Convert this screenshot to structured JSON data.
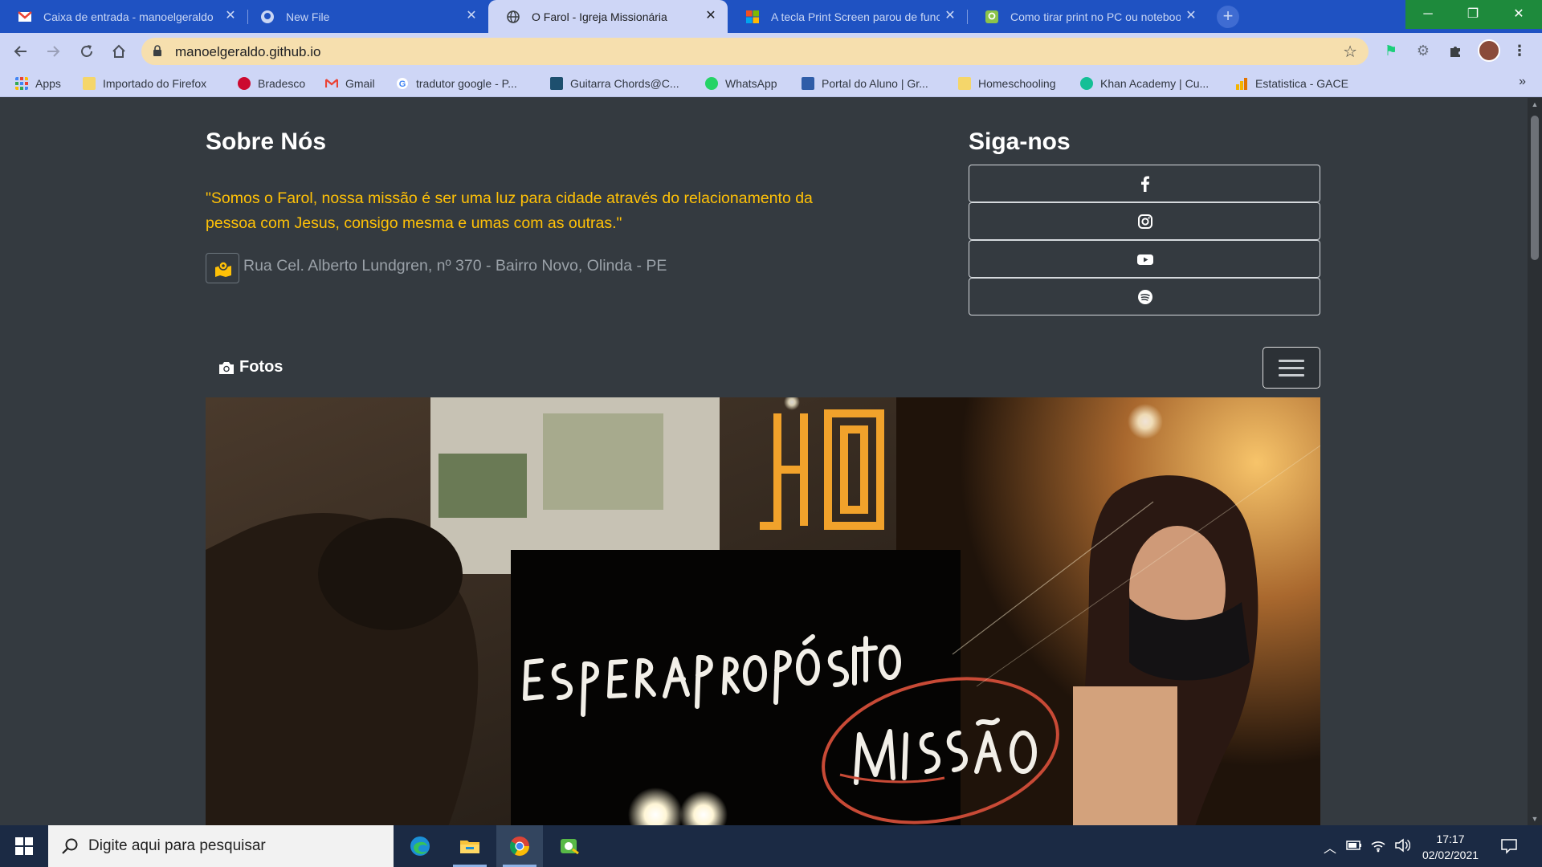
{
  "browser": {
    "tabs": [
      {
        "title": "Caixa de entrada - manoelgeraldo",
        "icon": "gmail-icon"
      },
      {
        "title": "New File",
        "icon": "github-icon"
      },
      {
        "title": "O Farol - Igreja Missionária",
        "icon": "globe-icon",
        "active": true
      },
      {
        "title": "A tecla Print Screen parou de funcionar",
        "icon": "microsoft-icon"
      },
      {
        "title": "Como tirar print no PC ou notebook",
        "icon": "tecmundo-icon"
      }
    ],
    "new_tab": "+",
    "close_glyph": "✕",
    "url": "manoelgeraldo.github.io",
    "window_controls": {
      "minimize": "─",
      "restore": "❐",
      "close": "✕"
    },
    "bookmarks": [
      {
        "label": "Apps",
        "icon": "apps-grid-icon"
      },
      {
        "label": "Importado do Firefox",
        "icon": "folder-icon"
      },
      {
        "label": "Bradesco",
        "icon": "bradesco-icon"
      },
      {
        "label": "Gmail",
        "icon": "gmail-icon"
      },
      {
        "label": "tradutor google - P...",
        "icon": "google-icon"
      },
      {
        "label": "Guitarra Chords@C...",
        "icon": "chords-icon"
      },
      {
        "label": "WhatsApp",
        "icon": "whatsapp-icon"
      },
      {
        "label": "Portal do Aluno | Gr...",
        "icon": "portal-icon"
      },
      {
        "label": "Homeschooling",
        "icon": "folder-icon"
      },
      {
        "label": "Khan Academy | Cu...",
        "icon": "khan-icon"
      },
      {
        "label": "Estatistica - GACE",
        "icon": "chart-icon"
      }
    ],
    "bookmarks_more": "»"
  },
  "page": {
    "about": {
      "heading": "Sobre Nós",
      "mission": "\"Somos o Farol, nossa missão é ser uma luz para cidade através do relacionamento da pessoa com Jesus, consigo mesma e umas com as outras.\"",
      "address": "Rua Cel. Alberto Lundgren, nº 370 - Bairro Novo, Olinda - PE"
    },
    "follow": {
      "heading": "Siga-nos",
      "networks": [
        "facebook-icon",
        "instagram-icon",
        "youtube-icon",
        "spotify-icon"
      ]
    },
    "photos": {
      "brand": "Fotos",
      "banner_logo": "HO",
      "banner_words": [
        "ESPERA",
        "PROPÓSITO",
        "MISSÃO"
      ]
    },
    "accent_color": "#ffc107",
    "background_color": "#343a40"
  },
  "taskbar": {
    "search_placeholder": "Digite aqui para pesquisar",
    "apps": [
      "edge-icon",
      "file-explorer-icon",
      "chrome-icon",
      "greenshot-icon"
    ],
    "time": "17:17",
    "date": "02/02/2021"
  }
}
